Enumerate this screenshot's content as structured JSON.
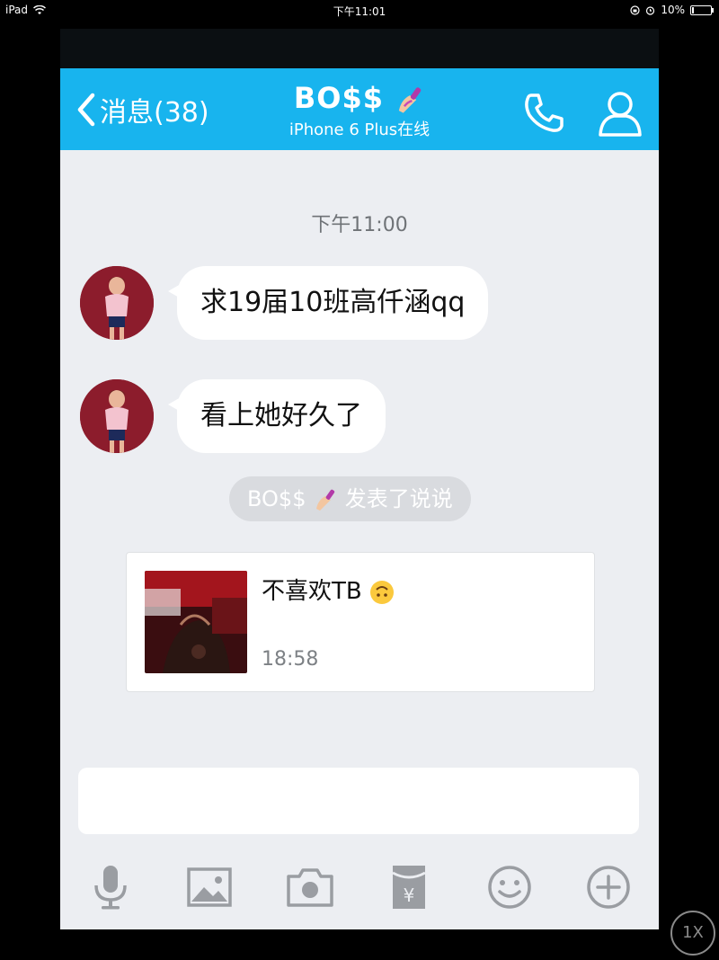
{
  "status_bar": {
    "device": "iPad",
    "time": "下午11:01",
    "battery": "10%"
  },
  "nav": {
    "back_label": "消息(38)",
    "title": "BO$$",
    "subtitle": "iPhone 6 Plus在线"
  },
  "chat": {
    "timestamp": "下午11:00",
    "messages": [
      {
        "text": "求19届10班高仟涵qq"
      },
      {
        "text": "看上她好久了"
      }
    ],
    "system_notice": {
      "name": "BO$$",
      "action": "发表了说说"
    },
    "post_card": {
      "text": "不喜欢TB",
      "time": "18:58"
    }
  },
  "input": {
    "placeholder": ""
  },
  "toolbar": {
    "icons": [
      "microphone-icon",
      "image-icon",
      "camera-icon",
      "red-packet-icon",
      "emoji-icon",
      "plus-icon"
    ]
  },
  "overlay": {
    "zoom_label": "1X"
  },
  "colors": {
    "nav_bg": "#18b4ee",
    "chat_bg": "#eceef2",
    "icon_gray": "#9a9da2"
  }
}
